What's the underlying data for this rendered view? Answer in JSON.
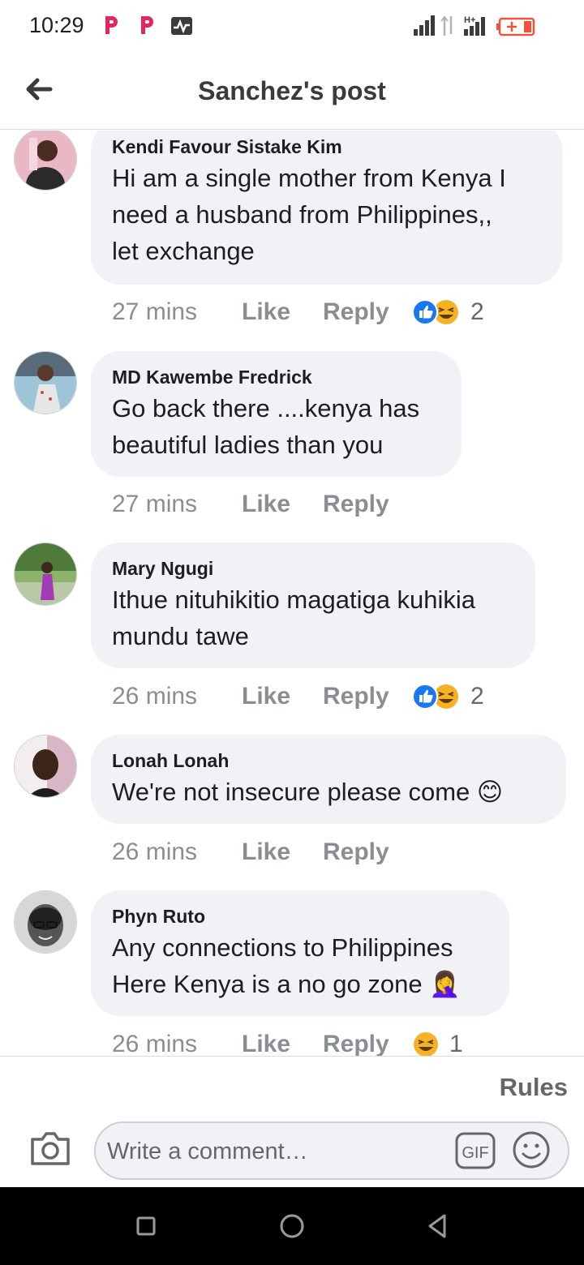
{
  "status_bar": {
    "time": "10:29"
  },
  "header": {
    "title": "Sanchez's post"
  },
  "comments": [
    {
      "author": "Kendi Favour Sistake Kim",
      "text": "Hi am a single mother from Kenya I\nneed a husband from Philippines,,\nlet exchange",
      "time": "27 mins",
      "like_label": "Like",
      "reply_label": "Reply",
      "reactions": [
        "like",
        "haha"
      ],
      "reaction_count": "2"
    },
    {
      "author": "MD Kawembe Fredrick",
      "text": "Go back there ....kenya has\nbeautiful ladies than you",
      "time": "27 mins",
      "like_label": "Like",
      "reply_label": "Reply"
    },
    {
      "author": "Mary Ngugi",
      "text": "Ithue nituhikitio magatiga kuhikia\nmundu tawe",
      "time": "26 mins",
      "like_label": "Like",
      "reply_label": "Reply",
      "reactions": [
        "like",
        "haha"
      ],
      "reaction_count": "2"
    },
    {
      "author": "Lonah Lonah",
      "text": "We're not insecure please come 😊",
      "time": "26 mins",
      "like_label": "Like",
      "reply_label": "Reply"
    },
    {
      "author": "Phyn Ruto",
      "text": "Any connections to Philippines\nHere Kenya is a no go zone 🤦‍♀️",
      "time": "26 mins",
      "like_label": "Like",
      "reply_label": "Reply",
      "reactions": [
        "haha"
      ],
      "reaction_count": "1"
    }
  ],
  "footer": {
    "rules_label": "Rules",
    "comment_placeholder": "Write a comment…",
    "gif_label": "GIF"
  },
  "colors": {
    "like_blue": "#1877f2",
    "haha_yellow": "#f7b125",
    "bubble_bg": "#f0f2f5",
    "meta_gray": "#8a8d91",
    "status_pink": "#e4255f",
    "battery_red": "#f0533b"
  }
}
